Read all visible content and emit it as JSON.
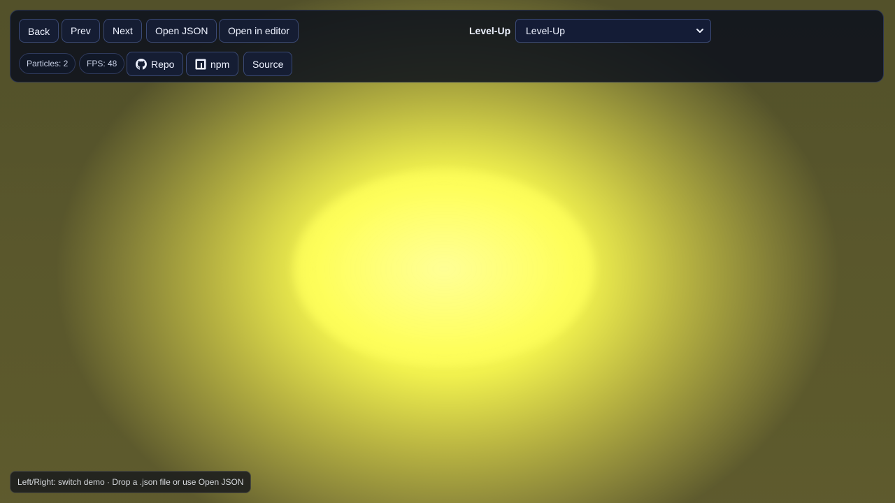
{
  "toolbar": {
    "back_label": "Back",
    "prev_label": "Prev",
    "next_label": "Next",
    "open_json_label": "Open JSON",
    "open_editor_label": "Open in editor",
    "particles_text": "Particles: 2",
    "fps_text": "FPS: 48",
    "repo_label": "Repo",
    "npm_label": "npm",
    "source_label": "Source"
  },
  "demo_select": {
    "label": "Level-Up",
    "value": "Level-Up"
  },
  "hint": "Left/Right: switch demo · Drop a .json file or use Open JSON",
  "icons": {
    "repo": "github-icon",
    "npm": "npm-icon",
    "select": "chevron-down-icon"
  },
  "colors": {
    "glow": "#ffff5a",
    "toolbar_bg": "#0c101c",
    "button_bg": "#151d33",
    "button_border": "#3b4a75"
  }
}
